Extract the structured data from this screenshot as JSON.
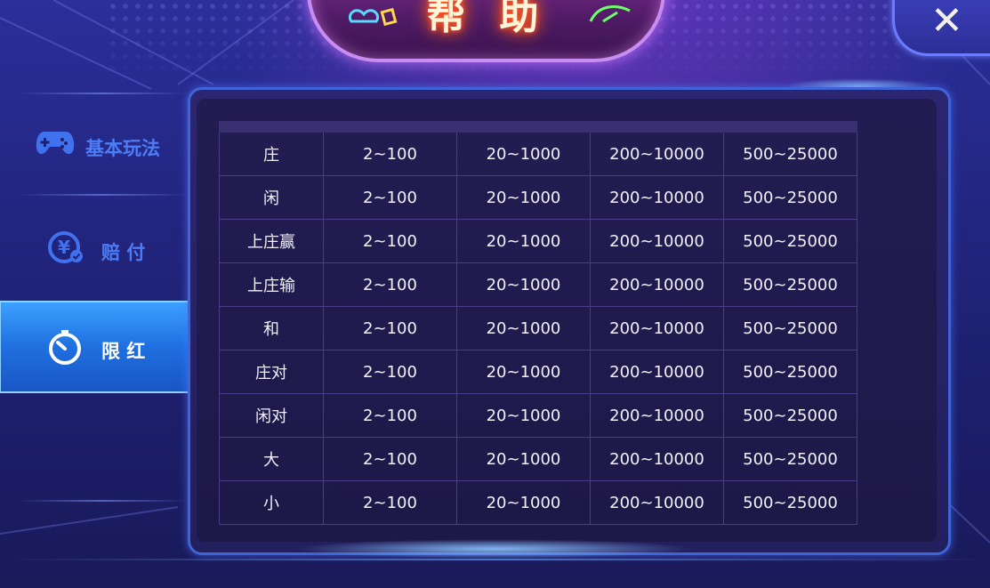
{
  "title": "帮助",
  "close_symbol": "✕",
  "sidebar": {
    "items": [
      {
        "label": "基本玩法",
        "icon": "gamepad-icon",
        "active": false
      },
      {
        "label": "赔 付",
        "icon": "yen-coin-icon",
        "active": false
      },
      {
        "label": "限 红",
        "icon": "timer-icon",
        "active": true
      }
    ]
  },
  "table": {
    "rows": [
      {
        "name": "庄",
        "values": [
          "2~100",
          "20~1000",
          "200~10000",
          "500~25000"
        ]
      },
      {
        "name": "闲",
        "values": [
          "2~100",
          "20~1000",
          "200~10000",
          "500~25000"
        ]
      },
      {
        "name": "上庄赢",
        "values": [
          "2~100",
          "20~1000",
          "200~10000",
          "500~25000"
        ]
      },
      {
        "name": "上庄输",
        "values": [
          "2~100",
          "20~1000",
          "200~10000",
          "500~25000"
        ]
      },
      {
        "name": "和",
        "values": [
          "2~100",
          "20~1000",
          "200~10000",
          "500~25000"
        ]
      },
      {
        "name": "庄对",
        "values": [
          "2~100",
          "20~1000",
          "200~10000",
          "500~25000"
        ]
      },
      {
        "name": "闲对",
        "values": [
          "2~100",
          "20~1000",
          "200~10000",
          "500~25000"
        ]
      },
      {
        "name": "大",
        "values": [
          "2~100",
          "20~1000",
          "200~10000",
          "500~25000"
        ]
      },
      {
        "name": "小",
        "values": [
          "2~100",
          "20~1000",
          "200~10000",
          "500~25000"
        ]
      }
    ]
  },
  "colors": {
    "accent": "#4c7df5",
    "panel_border": "#3e64d8",
    "title_glow": "#ff5a2a"
  }
}
